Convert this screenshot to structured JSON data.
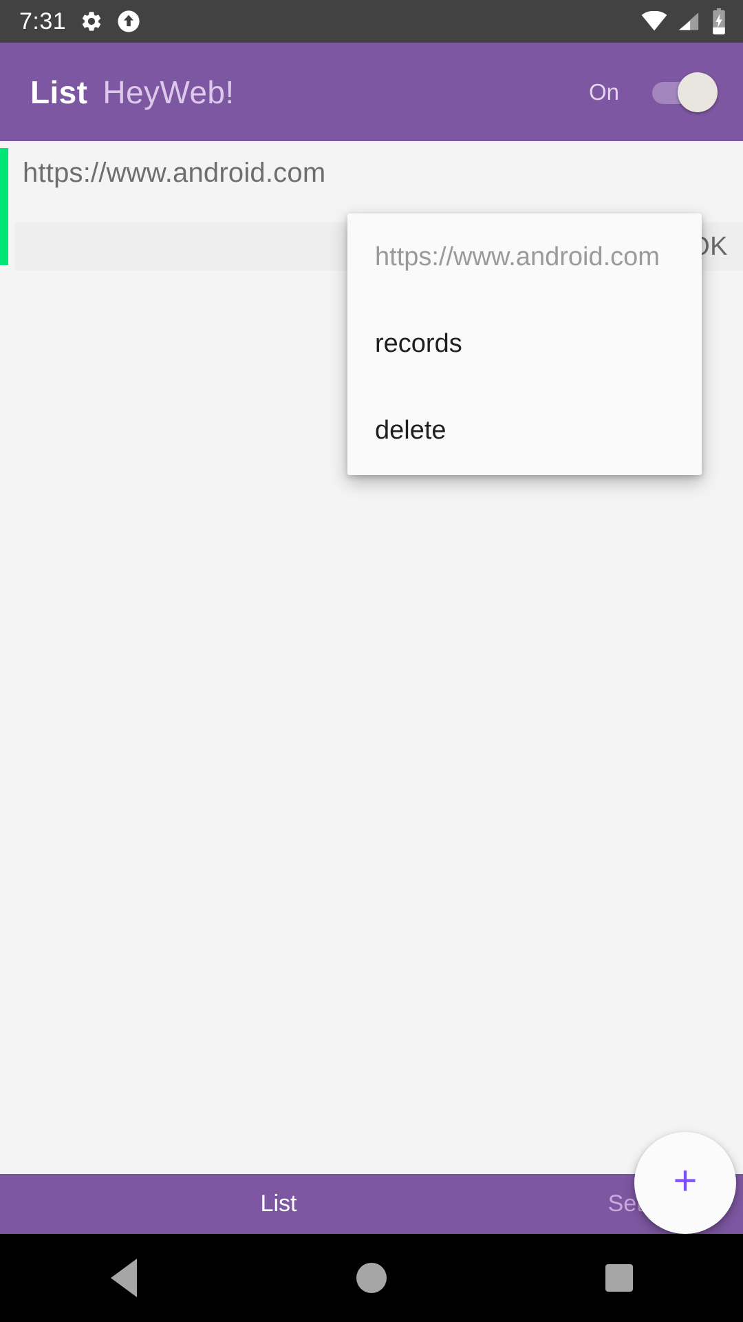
{
  "status_bar": {
    "clock": "7:31",
    "icons_left": [
      "gear-icon",
      "upload-arrow-icon"
    ],
    "icons_right": [
      "wifi-icon",
      "cellular-signal-icon",
      "battery-charging-icon"
    ],
    "background": "#424242"
  },
  "app_bar": {
    "title": "List",
    "subtitle": "HeyWeb!",
    "switch_label": "On",
    "switch_state": "on",
    "background": "#7e57a2"
  },
  "list": {
    "items": [
      {
        "url": "https://www.android.com",
        "accent_color": "#00e676",
        "ok_label": "OK"
      }
    ]
  },
  "popup_menu": {
    "header": "https://www.android.com",
    "items": [
      {
        "label": "records"
      },
      {
        "label": "delete"
      }
    ]
  },
  "bottom_tabs": {
    "tabs": [
      {
        "label": "List",
        "selected": true
      },
      {
        "label": "Settings",
        "selected": false
      }
    ]
  },
  "fab": {
    "icon_label": "+",
    "color": "#7c4dff"
  },
  "nav_bar": {
    "back": "back-icon",
    "home": "home-icon",
    "recents": "recents-icon"
  }
}
